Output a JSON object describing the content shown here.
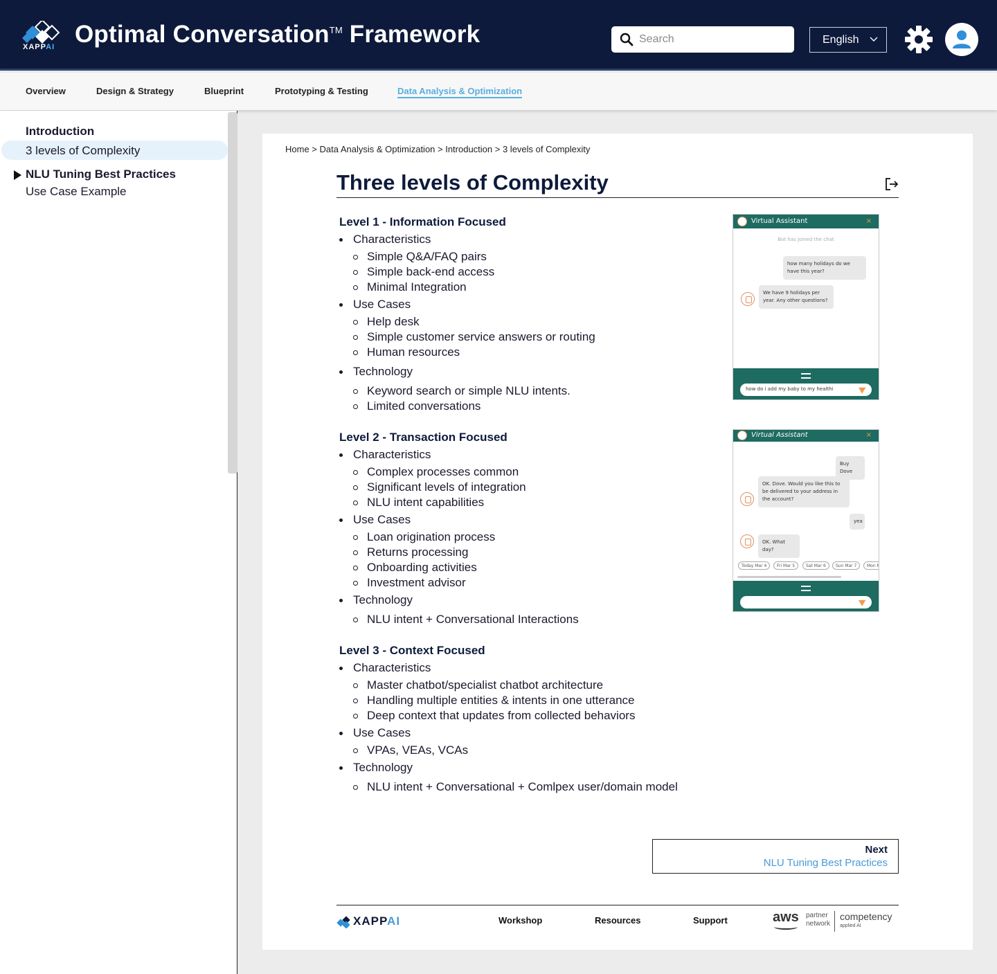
{
  "header": {
    "brand_text": "XAPP",
    "brand_text_ai": "AI",
    "title": "Optimal Conversation",
    "title_tm": "TM",
    "title_suffix": " Framework",
    "search_placeholder": "Search",
    "language": "English",
    "icons": [
      "search-icon",
      "chevron-down-icon",
      "gear-icon",
      "user-icon"
    ]
  },
  "tabs": [
    {
      "label": "Overview"
    },
    {
      "label": "Design & Strategy"
    },
    {
      "label": "Blueprint"
    },
    {
      "label": "Prototyping & Testing"
    },
    {
      "label": "Data Analysis & Optimization",
      "active": true
    }
  ],
  "sidebar": {
    "items": [
      {
        "label": "Introduction"
      },
      {
        "label": "3 levels of Complexity",
        "selected": true
      },
      {
        "label": "NLU Tuning Best Practices"
      },
      {
        "label": "Use Case Example"
      }
    ]
  },
  "main": {
    "breadcrumb": "Home > Data Analysis & Optimization > Introduction > 3 levels of Complexity",
    "title": "Three levels of Complexity",
    "levels": [
      {
        "heading": "Level 1 - Information Focused",
        "sections": [
          {
            "label": "Characteristics",
            "items": [
              "Simple Q&A/FAQ pairs",
              "Simple back-end access",
              "Minimal Integration"
            ]
          },
          {
            "label": "Use Cases",
            "items": [
              "Help desk",
              "Simple customer service answers or routing",
              "Human resources"
            ]
          },
          {
            "label": "Technology",
            "items": [
              "Keyword search or simple NLU intents.",
              "Limited conversations"
            ]
          }
        ]
      },
      {
        "heading": "Level 2 - Transaction Focused",
        "sections": [
          {
            "label": "Characteristics",
            "items": [
              "Complex processes common",
              "Significant levels of integration",
              "NLU intent capabilities"
            ]
          },
          {
            "label": "Use Cases",
            "items": [
              "Loan origination process",
              "Returns processing",
              "Onboarding activities",
              "Investment advisor"
            ]
          },
          {
            "label": "Technology",
            "items": [
              "NLU intent + Conversational Interactions"
            ]
          }
        ]
      },
      {
        "heading": "Level 3 - Context Focused",
        "sections": [
          {
            "label": "Characteristics",
            "items": [
              "Master chatbot/specialist chatbot architecture",
              "Handling multiple entities & intents in one utterance",
              "Deep context that updates from collected behaviors"
            ]
          },
          {
            "label": "Use Cases",
            "items": [
              "VPAs, VEAs, VCAs"
            ]
          },
          {
            "label": "Technology",
            "items": [
              "NLU intent + Conversational + Comlpex user/domain model"
            ]
          }
        ]
      }
    ],
    "chat1": {
      "title": "Virtual Assistant",
      "close": "×",
      "system": "Bot has joined the chat",
      "user_msg": "how many holidays do we have this year?",
      "bot_msg": "We have 9 holidays per year. Any other questions?",
      "input_value": "how do i add my baby to my healthi"
    },
    "chat2": {
      "title": "Virtual Assistant",
      "close": "×",
      "user_msg1": "Buy Dove",
      "bot_msg1": "OK. Dove. Would you like this to be delivered to your address in the account?",
      "user_msg2": "yea",
      "bot_msg2": "OK. What day?",
      "chips": [
        "Today Mar 4",
        "Fri Mar 5",
        "Sat Mar 6",
        "Sun Mar 7",
        "Mon M"
      ]
    },
    "next": {
      "label": "Next",
      "link": "NLU Tuning Best Practices"
    }
  },
  "footer": {
    "brand_text": "XAPP",
    "brand_text_ai": "AI",
    "links": [
      "Workshop",
      "Resources",
      "Support"
    ],
    "aws": {
      "aws": "aws",
      "partner": "partner",
      "network": "network",
      "competency": "competency",
      "applied": "applied AI"
    }
  }
}
